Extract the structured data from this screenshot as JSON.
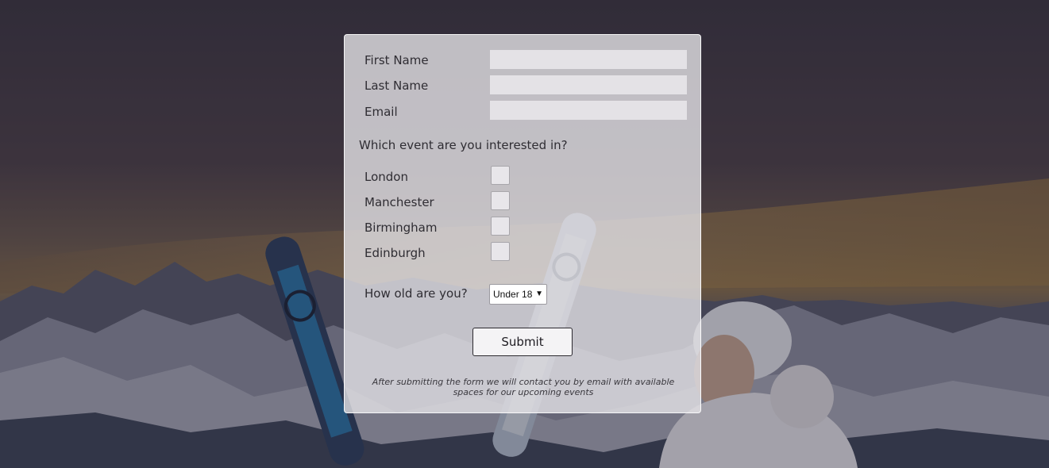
{
  "form": {
    "fields": [
      {
        "label": "First Name",
        "value": ""
      },
      {
        "label": "Last Name",
        "value": ""
      },
      {
        "label": "Email",
        "value": ""
      }
    ],
    "question": "Which event are you interested in?",
    "events": [
      {
        "label": "London",
        "checked": false
      },
      {
        "label": "Manchester",
        "checked": false
      },
      {
        "label": "Birmingham",
        "checked": false
      },
      {
        "label": "Edinburgh",
        "checked": false
      }
    ],
    "age_label": "How old are you?",
    "age_selected": "Under 18",
    "submit_label": "Submit",
    "note": "After submitting the form we will contact you by email with available spaces for our upcoming events"
  },
  "colors": {
    "card_bg": "#e4e2e6",
    "text": "#2f2d33"
  }
}
